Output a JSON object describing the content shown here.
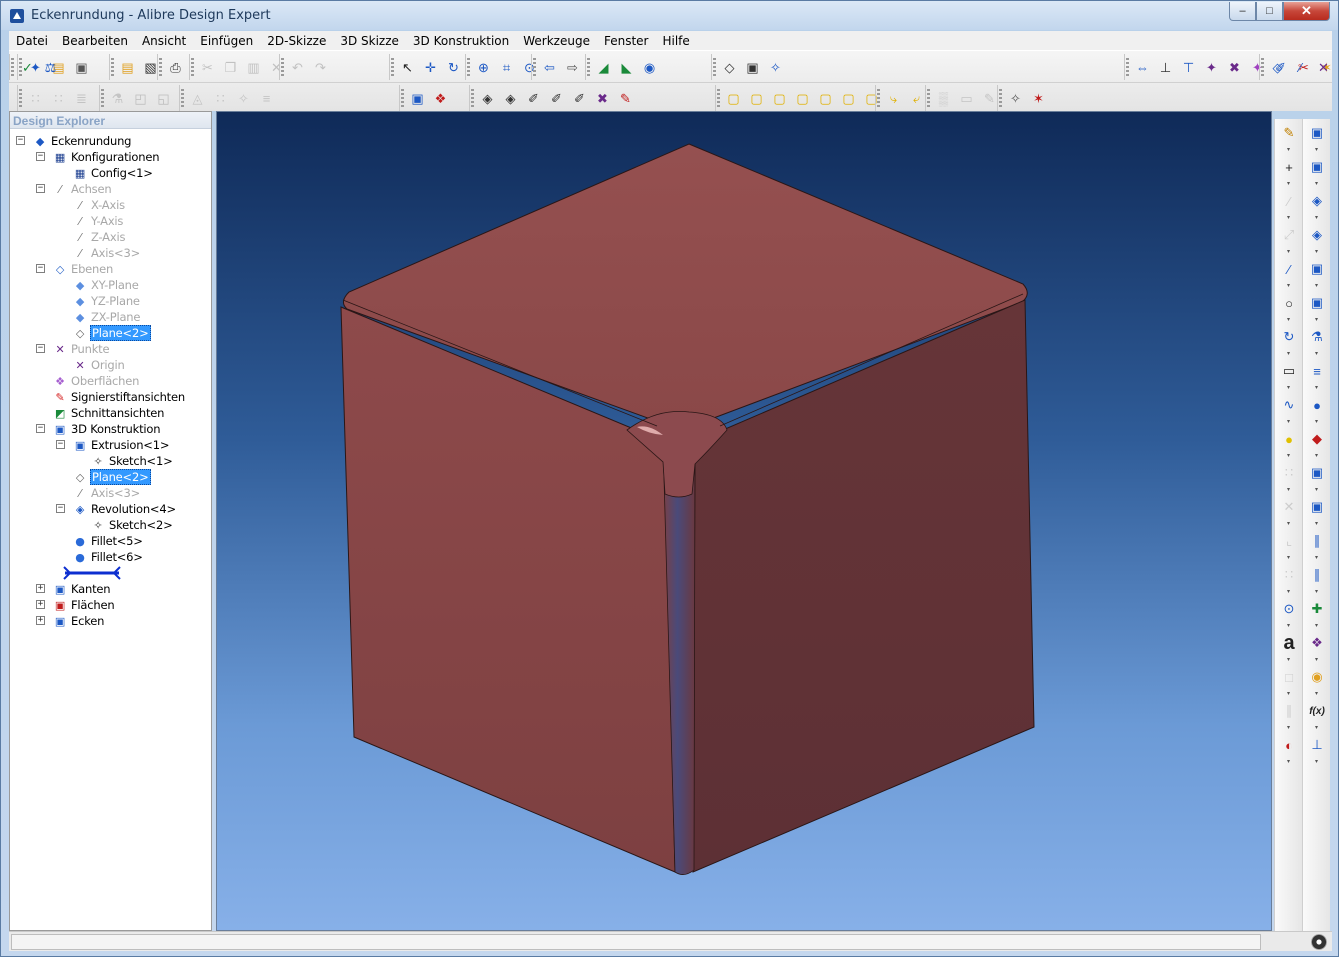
{
  "window": {
    "title": "Eckenrundung - Alibre Design Expert",
    "min_label": "–",
    "max_label": "□",
    "close_label": "✕"
  },
  "menu": [
    "Datei",
    "Bearbeiten",
    "Ansicht",
    "Einfügen",
    "2D-Skizze",
    "3D Skizze",
    "3D Konstruktion",
    "Werkzeuge",
    "Fenster",
    "Hilfe"
  ],
  "explorer": {
    "title": "Design Explorer",
    "nodes": [
      {
        "label": "Eckenrundung",
        "icon": "part-icon",
        "glyph": "◆",
        "color": "#1c58c4"
      },
      {
        "label": "Konfigurationen",
        "icon": "configurations-icon",
        "glyph": "▦",
        "color": "#1a3d8f"
      },
      {
        "label": "Config<1>",
        "icon": "config-icon",
        "glyph": "▦",
        "color": "#1a3d8f"
      },
      {
        "label": "Achsen",
        "icon": "axes-icon",
        "glyph": "⁄",
        "color": "#777"
      },
      {
        "label": "X-Axis",
        "icon": "axis-icon",
        "glyph": "⁄",
        "color": "#777"
      },
      {
        "label": "Y-Axis",
        "icon": "axis-icon",
        "glyph": "⁄",
        "color": "#777"
      },
      {
        "label": "Z-Axis",
        "icon": "axis-icon",
        "glyph": "⁄",
        "color": "#777"
      },
      {
        "label": "Axis<3>",
        "icon": "axis-icon",
        "glyph": "⁄",
        "color": "#777"
      },
      {
        "label": "Ebenen",
        "icon": "planes-icon",
        "glyph": "◇",
        "color": "#2c66c8"
      },
      {
        "label": "XY-Plane",
        "icon": "plane-icon",
        "glyph": "◆",
        "color": "#5c8fe0"
      },
      {
        "label": "YZ-Plane",
        "icon": "plane-icon",
        "glyph": "◆",
        "color": "#5c8fe0"
      },
      {
        "label": "ZX-Plane",
        "icon": "plane-icon",
        "glyph": "◆",
        "color": "#5c8fe0"
      },
      {
        "label": "Plane<2>",
        "icon": "plane-icon",
        "glyph": "◇",
        "color": "#666"
      },
      {
        "label": "Punkte",
        "icon": "points-icon",
        "glyph": "✕",
        "color": "#6a2a8a"
      },
      {
        "label": "Origin",
        "icon": "origin-icon",
        "glyph": "✕",
        "color": "#6a2a8a"
      },
      {
        "label": "Oberflächen",
        "icon": "surfaces-icon",
        "glyph": "❖",
        "color": "#a65fd0"
      },
      {
        "label": "Signierstiftansichten",
        "icon": "redline-views-icon",
        "glyph": "✎",
        "color": "#d42020"
      },
      {
        "label": "Schnittansichten",
        "icon": "section-views-icon",
        "glyph": "◩",
        "color": "#1a8a3a"
      },
      {
        "label": "3D Konstruktion",
        "icon": "construction-icon",
        "glyph": "▣",
        "color": "#1c58c4"
      },
      {
        "label": "Extrusion<1>",
        "icon": "extrusion-icon",
        "glyph": "▣",
        "color": "#1c58c4"
      },
      {
        "label": "Sketch<1>",
        "icon": "sketch-icon",
        "glyph": "✧",
        "color": "#333"
      },
      {
        "label": "Plane<2>",
        "icon": "plane-icon",
        "glyph": "◇",
        "color": "#666"
      },
      {
        "label": "Axis<3>",
        "icon": "axis-icon",
        "glyph": "⁄",
        "color": "#777"
      },
      {
        "label": "Revolution<4>",
        "icon": "revolution-icon",
        "glyph": "◈",
        "color": "#1c58c4"
      },
      {
        "label": "Sketch<2>",
        "icon": "sketch-icon",
        "glyph": "✧",
        "color": "#333"
      },
      {
        "label": "Fillet<5>",
        "icon": "fillet-icon",
        "glyph": "●",
        "color": "#2a6ad8"
      },
      {
        "label": "Fillet<6>",
        "icon": "fillet-icon",
        "glyph": "●",
        "color": "#2a6ad8"
      },
      {
        "label": "",
        "icon": "end-of-part-marker-icon",
        "glyph": "",
        "color": "#0d2fd0"
      },
      {
        "label": "Kanten",
        "icon": "edges-icon",
        "glyph": "▣",
        "color": "#1c58c4"
      },
      {
        "label": "Flächen",
        "icon": "faces-icon",
        "glyph": "▣",
        "color": "#c01c1c"
      },
      {
        "label": "Ecken",
        "icon": "vertices-icon",
        "glyph": "▣",
        "color": "#1c58c4"
      }
    ]
  },
  "toolbar_icons": {
    "row1": [
      [
        [
          "new-part-icon",
          "✦",
          "#1c58c4"
        ],
        [
          "open-icon",
          "▤",
          "#e0a020"
        ],
        [
          "save-icon",
          "▣",
          "#555"
        ]
      ],
      [
        [
          "open-folder-icon",
          "▤",
          "#e0a020"
        ],
        [
          "print-preview-icon",
          "▧",
          "#333"
        ]
      ],
      [
        [
          "print-icon",
          "⎙",
          "#333"
        ]
      ],
      [
        [
          "cut-icon",
          "✂",
          "#888"
        ],
        [
          "copy-icon",
          "❐",
          "#888"
        ],
        [
          "paste-icon",
          "▥",
          "#888"
        ],
        [
          "delete-icon",
          "✕",
          "#888"
        ]
      ],
      [
        [
          "undo-icon",
          "↶",
          "#888"
        ],
        [
          "redo-icon",
          "↷",
          "#888"
        ]
      ],
      [
        [
          "select-icon",
          "↖",
          "#222"
        ],
        [
          "pan-icon",
          "✛",
          "#1c58c4"
        ],
        [
          "rotate-icon",
          "↻",
          "#1c58c4"
        ]
      ],
      [
        [
          "zoom-in-icon",
          "⊕",
          "#1c58c4"
        ],
        [
          "zoom-window-icon",
          "⌗",
          "#1c58c4"
        ],
        [
          "zoom-fit-icon",
          "⊙",
          "#1c58c4"
        ]
      ],
      [
        [
          "previous-view-icon",
          "⇦",
          "#1c58c4"
        ],
        [
          "next-view-icon",
          "⇨",
          "#555"
        ]
      ],
      [
        [
          "plane-view-icon",
          "◢",
          "#1a8a3a"
        ],
        [
          "normal-view-icon",
          "◣",
          "#1a8a3a"
        ],
        [
          "orbit-icon",
          "◉",
          "#1c58c4"
        ]
      ],
      [
        [
          "render-icon",
          "◇",
          "#333"
        ],
        [
          "display-mode-icon",
          "▣",
          "#333"
        ],
        [
          "view-options-icon",
          "✧",
          "#1c58c4"
        ]
      ],
      [
        [
          "dimension-icon",
          "⇔",
          "#1c58c4"
        ],
        [
          "constraint-icon",
          "⊥",
          "#333"
        ],
        [
          "align-icon",
          "⊤",
          "#1c58c4"
        ],
        [
          "mate-icon",
          "✦",
          "#6a2a8a"
        ],
        [
          "orient-icon",
          "✖",
          "#6a2a8a"
        ],
        [
          "tangent-icon",
          "✦",
          "#a040c0"
        ],
        [
          "reference-icon",
          "✐",
          "#1c58c4"
        ],
        [
          "section-icon",
          "✂",
          "#c01c1c"
        ],
        [
          "measure-icon",
          "✶",
          "#e0a020"
        ],
        [
          "analysis-icon",
          "✦",
          "#1c58c4"
        ],
        [
          "sketch-tools-icon",
          "✡",
          "#1c58c4"
        ]
      ],
      [
        [
          "plane-tool-icon",
          "◇",
          "#1c58c4"
        ],
        [
          "axis-tool-icon",
          "⁄",
          "#1c58c4"
        ],
        [
          "point-tool-icon",
          "✕",
          "#6a2a8a"
        ],
        [
          "table-icon",
          "▦",
          "#1a3d8f"
        ],
        [
          "material-icon",
          "◩",
          "#1a8a3a"
        ]
      ],
      [
        [
          "checkmark-icon",
          "✓",
          "#1a8a3a"
        ],
        [
          "balance-icon",
          "⚖",
          "#1c58c4"
        ]
      ]
    ],
    "row2": [
      [
        [
          "grid-icon",
          "∷",
          "#999"
        ],
        [
          "snap-icon",
          "∷",
          "#999"
        ],
        [
          "bom-icon",
          "≣",
          "#999"
        ]
      ],
      [
        [
          "link-icon",
          "⚗",
          "#999"
        ],
        [
          "copy-feature-icon",
          "◰",
          "#888"
        ],
        [
          "mirror-icon",
          "◱",
          "#888"
        ]
      ],
      [
        [
          "hide-icon",
          "◬",
          "#999"
        ],
        [
          "grid-display-icon",
          "∷",
          "#999"
        ],
        [
          "snap-grid-icon",
          "✧",
          "#999"
        ],
        [
          "table-grid-icon",
          "≡",
          "#999"
        ]
      ],
      [
        [
          "part-style-icon",
          "▣",
          "#1c58c4"
        ],
        [
          "color-icon",
          "❖",
          "#c01c1c"
        ]
      ],
      [
        [
          "feature-1-icon",
          "◈",
          "#333"
        ],
        [
          "feature-2-icon",
          "◈",
          "#333"
        ],
        [
          "feature-3-icon",
          "✐",
          "#333"
        ],
        [
          "feature-4-icon",
          "✐",
          "#333"
        ],
        [
          "feature-5-icon",
          "✐",
          "#333"
        ],
        [
          "feature-6-icon",
          "✖",
          "#6a2a8a"
        ],
        [
          "feature-7-icon",
          "✎",
          "#c01c1c"
        ]
      ],
      [
        [
          "view-front-icon",
          "▢",
          "#e0b000"
        ],
        [
          "view-back-icon",
          "▢",
          "#e0b000"
        ],
        [
          "view-top-icon",
          "▢",
          "#e0b000"
        ],
        [
          "view-bottom-icon",
          "▢",
          "#e0b000"
        ],
        [
          "view-left-icon",
          "▢",
          "#e0b000"
        ],
        [
          "view-right-icon",
          "▢",
          "#e0b000"
        ],
        [
          "view-iso-icon",
          "▢",
          "#e0b000"
        ]
      ],
      [
        [
          "turn-left-icon",
          "⤷",
          "#e0b000"
        ],
        [
          "turn-right-icon",
          "⤶",
          "#e0b000"
        ]
      ],
      [
        [
          "hatch-icon",
          "▒",
          "#999"
        ],
        [
          "eraser-icon",
          "▭",
          "#999"
        ],
        [
          "brush-icon",
          "✎",
          "#999"
        ]
      ],
      [
        [
          "wand-icon",
          "✧",
          "#555"
        ],
        [
          "compass-icon",
          "✶",
          "#c01c1c"
        ]
      ]
    ]
  },
  "palette_left": [
    [
      "sketch-mode-icon",
      "✎",
      "#c08000",
      false
    ],
    [
      "crosshair-icon",
      "+",
      "#222",
      false
    ],
    [
      "construction-line-icon",
      "∕",
      "#999",
      true
    ],
    [
      "dimension-line-icon",
      "⤢",
      "#999",
      true
    ],
    [
      "line-icon",
      "∕",
      "#1c58c4",
      false
    ],
    [
      "circle-icon",
      "○",
      "#222",
      false
    ],
    [
      "arc-icon",
      "↻",
      "#1c58c4",
      false
    ],
    [
      "rectangle-icon",
      "▭",
      "#222",
      false
    ],
    [
      "curve-icon",
      "∿",
      "#1c58c4",
      false
    ],
    [
      "point-icon",
      "●",
      "#e0c000",
      false
    ],
    [
      "offset-icon",
      "∷",
      "#999",
      true
    ],
    [
      "trim-icon",
      "✕",
      "#999",
      true
    ],
    [
      "fillet-sketch-icon",
      "⌞",
      "#999",
      true
    ],
    [
      "pattern-icon",
      "∷",
      "#999",
      true
    ],
    [
      "center-icon",
      "⊙",
      "#1c58c4",
      false
    ],
    [
      "text-icon",
      "a",
      "#222",
      false
    ],
    [
      "copy-sketch-icon",
      "□",
      "#999",
      true
    ],
    [
      "mirror-sketch-icon",
      "∥",
      "#999",
      true
    ],
    [
      "color-fill-icon",
      "◐",
      "#c01c1c",
      false
    ]
  ],
  "palette_right": [
    [
      "extrude-boss-icon",
      "▣",
      "#1c58c4"
    ],
    [
      "extrude-cut-icon",
      "▣",
      "#1c58c4"
    ],
    [
      "revolve-boss-icon",
      "◈",
      "#1c58c4"
    ],
    [
      "revolve-cut-icon",
      "◈",
      "#1c58c4"
    ],
    [
      "sweep-icon",
      "▣",
      "#1c58c4"
    ],
    [
      "loft-icon",
      "▣",
      "#1c58c4"
    ],
    [
      "hole-icon",
      "⚗",
      "#1c58c4"
    ],
    [
      "thread-icon",
      "≡",
      "#1c58c4"
    ],
    [
      "fillet-feature-icon",
      "●",
      "#1c58c4"
    ],
    [
      "chamfer-icon",
      "◆",
      "#c01c1c"
    ],
    [
      "shell-icon",
      "▣",
      "#1c58c4"
    ],
    [
      "draft-icon",
      "▣",
      "#1c58c4"
    ],
    [
      "rib-icon",
      "∥",
      "#1c58c4"
    ],
    [
      "scale-icon",
      "∥",
      "#1c58c4"
    ],
    [
      "boolean-icon",
      "✚",
      "#1a8a3a"
    ],
    [
      "split-icon",
      "❖",
      "#6a2a8a"
    ],
    [
      "replace-face-icon",
      "◉",
      "#e0a020"
    ],
    [
      "equation-icon",
      "f(x)",
      "#222"
    ],
    [
      "dimension-table-icon",
      "⊥",
      "#1c58c4"
    ]
  ],
  "status": {
    "text": ""
  }
}
